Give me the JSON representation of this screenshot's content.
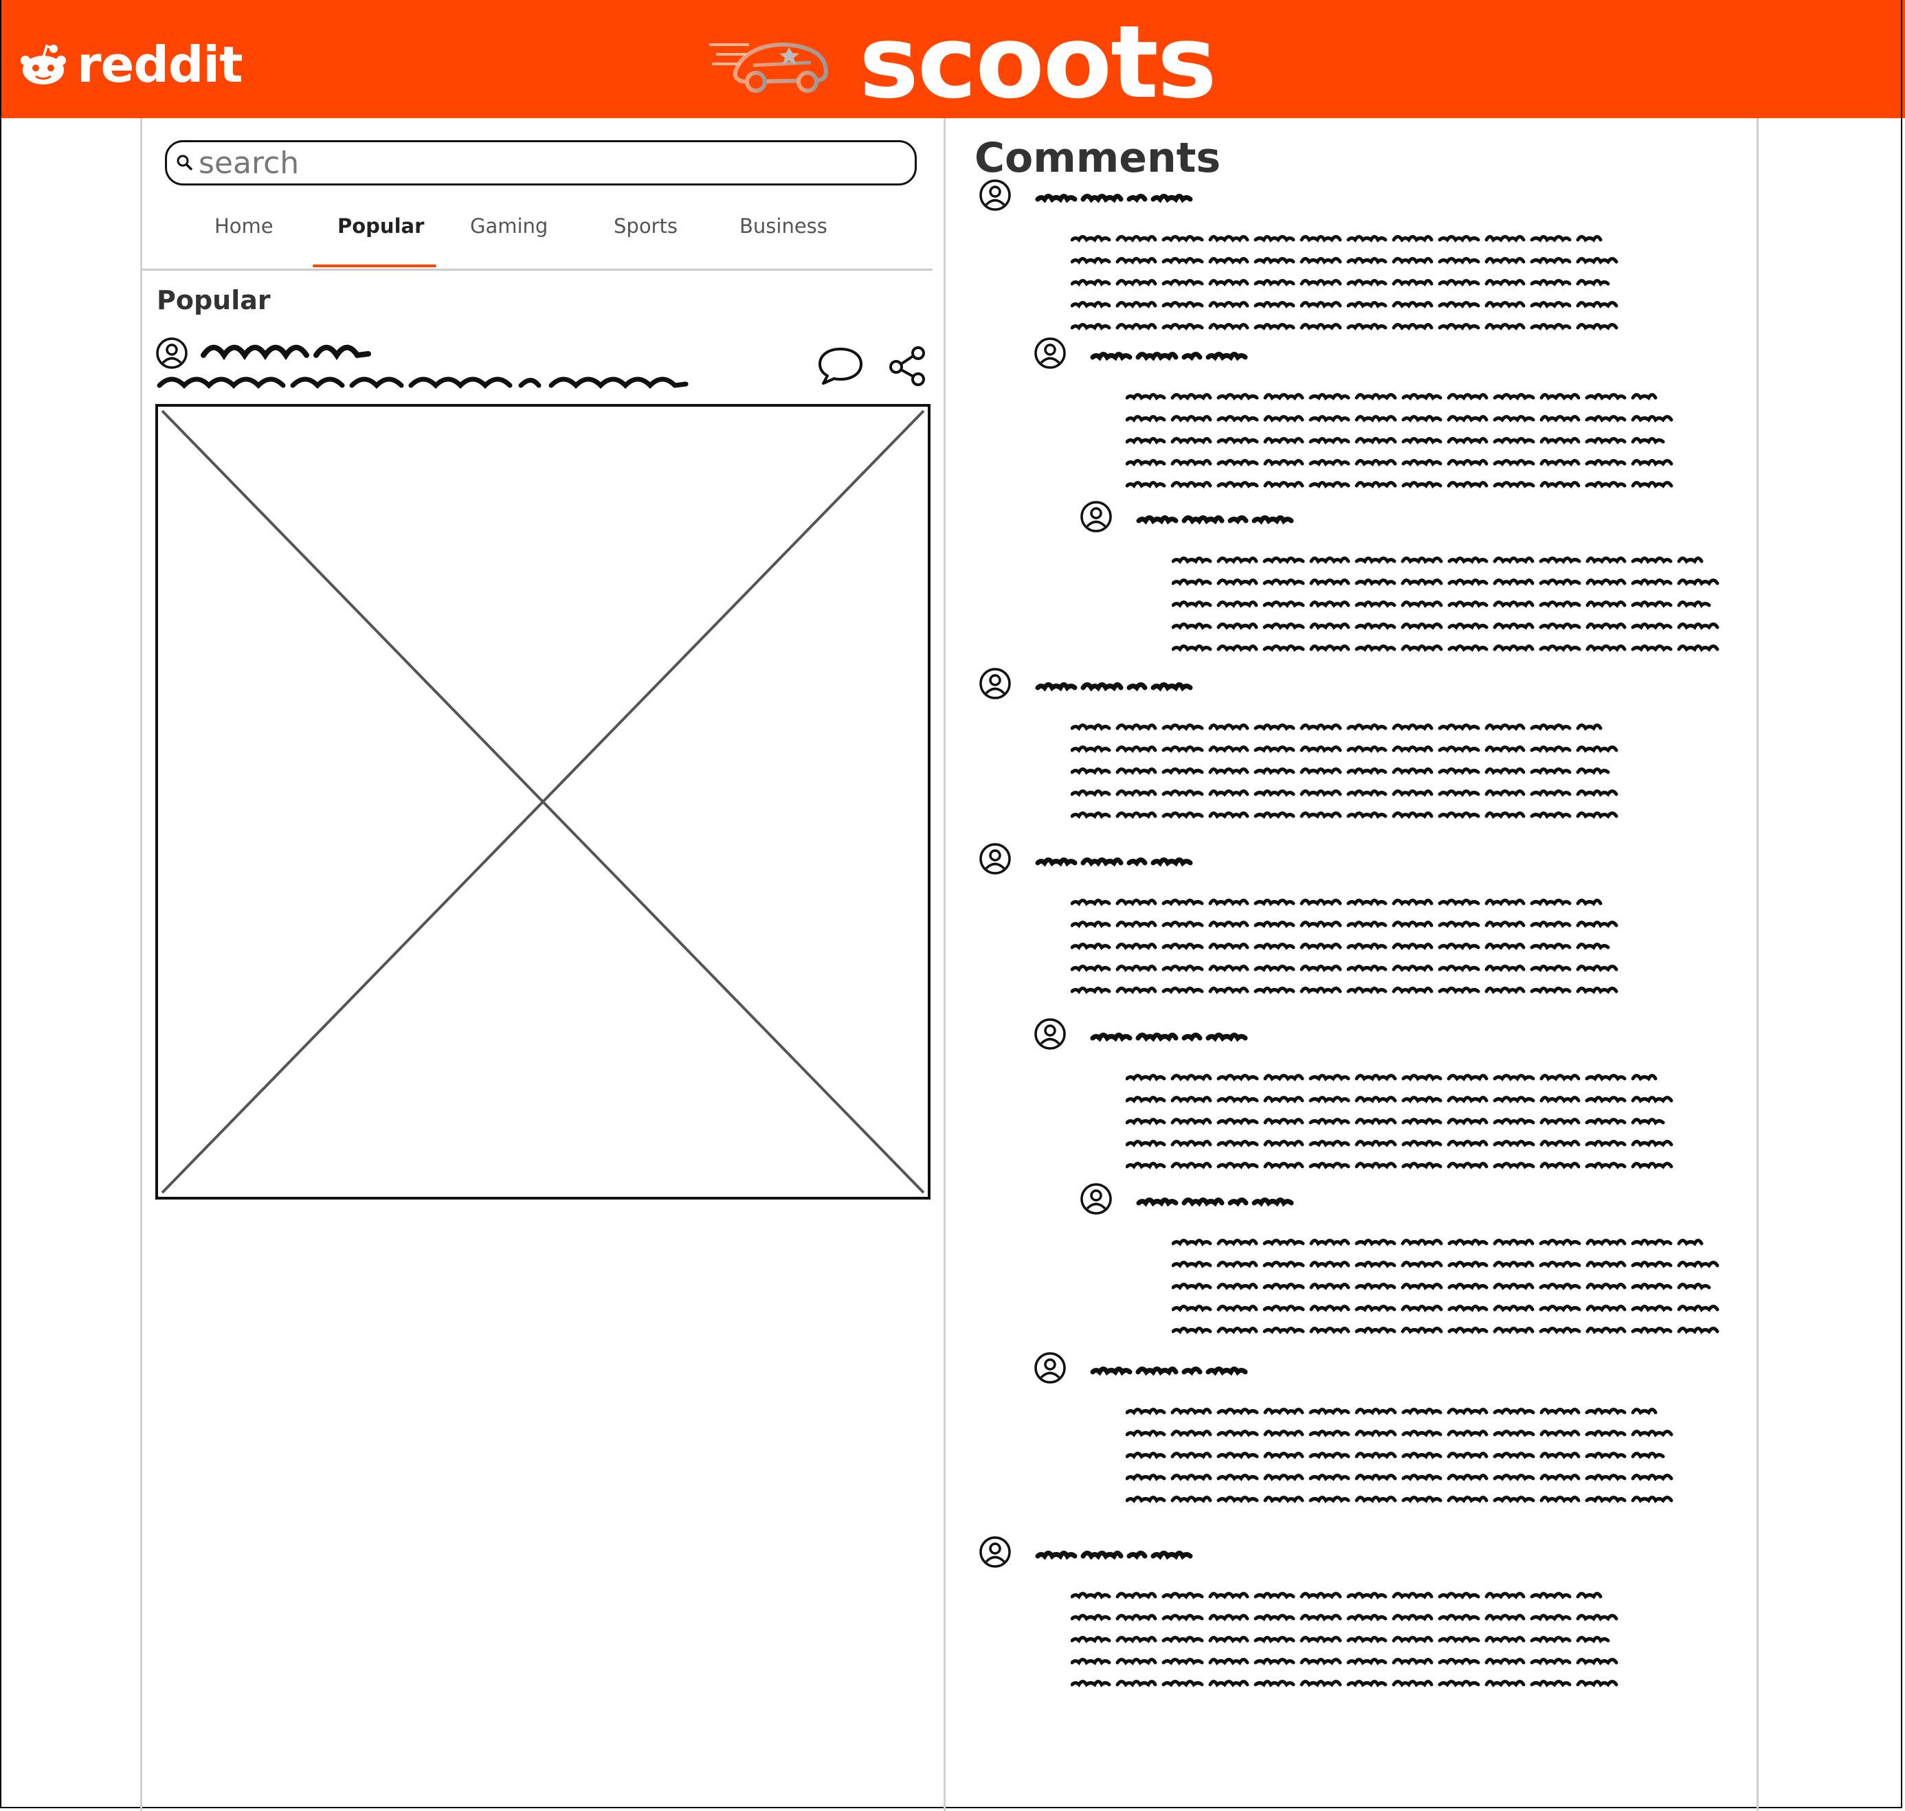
{
  "header": {
    "reddit_wordmark": "reddit",
    "brand_name": "scoots",
    "background_color": "#ff4500",
    "icons": [
      "reddit-alien-icon",
      "car-logo-icon"
    ]
  },
  "search": {
    "placeholder": "search",
    "value": ""
  },
  "tabs": [
    {
      "label": "Home",
      "active": false
    },
    {
      "label": "Popular",
      "active": true
    },
    {
      "label": "Gaming",
      "active": false
    },
    {
      "label": "Sports",
      "active": false
    },
    {
      "label": "Business",
      "active": false
    }
  ],
  "feed": {
    "section_title": "Popular",
    "post": {
      "has_image_placeholder": true,
      "actions": [
        "comment-icon",
        "share-icon"
      ]
    }
  },
  "comments": {
    "title": "Comments",
    "thread": [
      {
        "depth": 0
      },
      {
        "depth": 1
      },
      {
        "depth": 2
      },
      {
        "depth": 0
      },
      {
        "depth": 0
      },
      {
        "depth": 1
      },
      {
        "depth": 2
      },
      {
        "depth": 1
      },
      {
        "depth": 0
      }
    ]
  },
  "colors": {
    "accent": "#ff4500",
    "text": "#333333",
    "divider": "#cccccc"
  }
}
